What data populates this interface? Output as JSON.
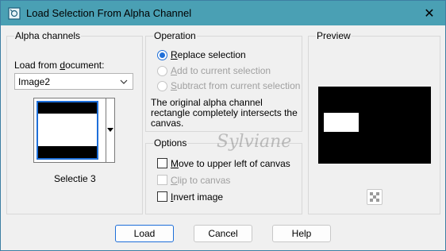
{
  "window": {
    "title": "Load Selection From Alpha Channel",
    "close_glyph": "✕"
  },
  "alpha": {
    "group_title": "Alpha channels",
    "load_from_label_pre": "Load from ",
    "load_from_label_accel": "d",
    "load_from_label_post": "ocument:",
    "document_value": "Image2",
    "channel_name": "Selectie 3"
  },
  "operation": {
    "group_title": "Operation",
    "replace_pre": "",
    "replace_accel": "R",
    "replace_post": "eplace selection",
    "add_pre": "",
    "add_accel": "A",
    "add_post": "dd to current selection",
    "subtract_pre": "",
    "subtract_accel": "S",
    "subtract_post": "ubtract from current selection",
    "info_line1": "The original alpha channel",
    "info_line2": "rectangle completely intersects the",
    "info_line3": "canvas."
  },
  "options": {
    "group_title": "Options",
    "move_pre": "",
    "move_accel": "M",
    "move_post": "ove to upper left of canvas",
    "clip_pre": "",
    "clip_accel": "C",
    "clip_post": "lip to canvas",
    "invert_pre": "",
    "invert_accel": "I",
    "invert_post": "nvert image"
  },
  "preview": {
    "group_title": "Preview"
  },
  "watermark": "Sylviane",
  "buttons": {
    "load": "Load",
    "cancel": "Cancel",
    "help": "Help"
  },
  "colors": {
    "titlebar": "#4aa0b4",
    "accent": "#1e6fd9"
  }
}
